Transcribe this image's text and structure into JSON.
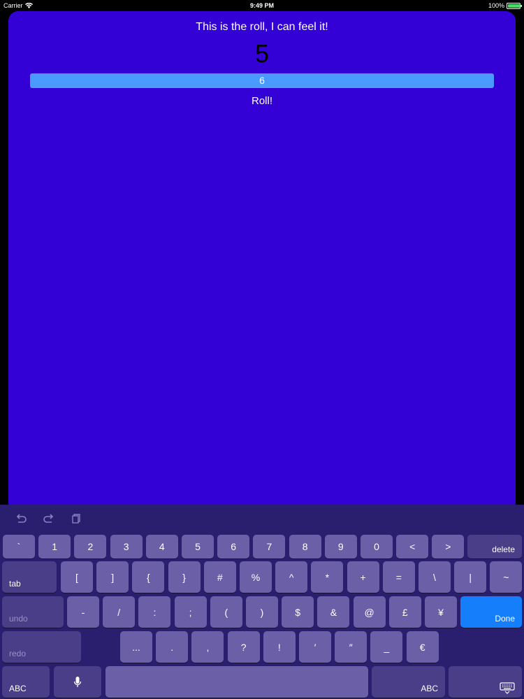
{
  "status_bar": {
    "carrier": "Carrier",
    "time": "9:49 PM",
    "battery": "100%",
    "battery_level": 1.0
  },
  "app": {
    "title": "This is the roll, I can feel it!",
    "result": "5",
    "input_value": "6",
    "roll_label": "Roll!",
    "background": "#3300d6",
    "field_color": "#4a9aff"
  },
  "keyboard": {
    "toolbar": [
      "undo-arrow-icon",
      "redo-arrow-icon",
      "clipboard-icon"
    ],
    "row1": [
      "`",
      "1",
      "2",
      "3",
      "4",
      "5",
      "6",
      "7",
      "8",
      "9",
      "0",
      "<",
      ">"
    ],
    "delete": "delete",
    "tab": "tab",
    "row2": [
      "[",
      "]",
      "{",
      "}",
      "#",
      "%",
      "^",
      "*",
      "+",
      "=",
      "\\",
      "|",
      "~"
    ],
    "undo": "undo",
    "row3": [
      "-",
      "/",
      ":",
      ";",
      "(",
      ")",
      "$",
      "&",
      "@",
      "£",
      "¥"
    ],
    "done": "Done",
    "redo": "redo",
    "row4": [
      "...",
      ".",
      ",",
      "?",
      "!",
      "′",
      "″",
      "_",
      "€"
    ],
    "abc_left": "ABC",
    "abc_right": "ABC",
    "done_color": "#147efb"
  }
}
